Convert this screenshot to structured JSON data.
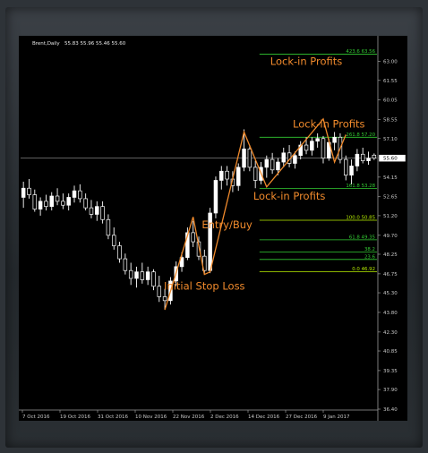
{
  "chart_data": {
    "type": "candlestick",
    "header": {
      "symbol": "Brent,Daily",
      "ohlc": "55.83 55.96 55.46 55.60"
    },
    "y_ticks": [
      "63.00",
      "61.55",
      "60.05",
      "58.55",
      "57.10",
      "55.60",
      "54.15",
      "52.65",
      "51.20",
      "49.70",
      "48.25",
      "46.75",
      "45.30",
      "43.80",
      "42.30",
      "40.85",
      "39.35",
      "37.90",
      "36.40"
    ],
    "current_price": "55.60",
    "ylim": [
      36.4,
      64.0
    ],
    "x_ticks": [
      "7 Oct 2016",
      "19 Oct 2016",
      "31 Oct 2016",
      "10 Nov 2016",
      "22 Nov 2016",
      "2 Dec 2016",
      "14 Dec 2016",
      "27 Dec 2016",
      "9 Jan 2017"
    ],
    "candles": [
      {
        "o": 52.6,
        "h": 53.8,
        "l": 51.8,
        "c": 53.3
      },
      {
        "o": 53.3,
        "h": 54.0,
        "l": 52.5,
        "c": 52.8
      },
      {
        "o": 52.8,
        "h": 53.2,
        "l": 51.5,
        "c": 51.7
      },
      {
        "o": 51.7,
        "h": 52.6,
        "l": 51.2,
        "c": 52.3
      },
      {
        "o": 52.3,
        "h": 52.8,
        "l": 51.6,
        "c": 51.9
      },
      {
        "o": 51.9,
        "h": 53.0,
        "l": 51.6,
        "c": 52.7
      },
      {
        "o": 52.7,
        "h": 53.3,
        "l": 52.0,
        "c": 52.3
      },
      {
        "o": 52.3,
        "h": 52.9,
        "l": 51.7,
        "c": 52.0
      },
      {
        "o": 52.0,
        "h": 52.9,
        "l": 51.6,
        "c": 52.6
      },
      {
        "o": 52.6,
        "h": 53.5,
        "l": 52.2,
        "c": 53.1
      },
      {
        "o": 53.1,
        "h": 53.6,
        "l": 52.2,
        "c": 52.5
      },
      {
        "o": 52.5,
        "h": 52.9,
        "l": 51.6,
        "c": 51.8
      },
      {
        "o": 51.8,
        "h": 52.4,
        "l": 51.0,
        "c": 51.3
      },
      {
        "o": 51.3,
        "h": 52.3,
        "l": 50.8,
        "c": 51.9
      },
      {
        "o": 51.9,
        "h": 52.3,
        "l": 50.6,
        "c": 50.9
      },
      {
        "o": 50.9,
        "h": 51.3,
        "l": 49.4,
        "c": 49.7
      },
      {
        "o": 49.7,
        "h": 50.3,
        "l": 48.6,
        "c": 48.9
      },
      {
        "o": 48.9,
        "h": 49.2,
        "l": 47.6,
        "c": 47.9
      },
      {
        "o": 47.9,
        "h": 48.3,
        "l": 46.7,
        "c": 47.0
      },
      {
        "o": 47.0,
        "h": 47.6,
        "l": 45.9,
        "c": 46.4
      },
      {
        "o": 46.4,
        "h": 47.3,
        "l": 45.7,
        "c": 46.9
      },
      {
        "o": 46.9,
        "h": 47.6,
        "l": 46.0,
        "c": 46.3
      },
      {
        "o": 46.3,
        "h": 47.3,
        "l": 45.9,
        "c": 46.9
      },
      {
        "o": 46.9,
        "h": 47.1,
        "l": 45.5,
        "c": 45.8
      },
      {
        "o": 45.8,
        "h": 46.6,
        "l": 44.6,
        "c": 45.0
      },
      {
        "o": 45.0,
        "h": 45.6,
        "l": 44.0,
        "c": 44.7
      },
      {
        "o": 44.7,
        "h": 46.5,
        "l": 44.4,
        "c": 46.2
      },
      {
        "o": 46.2,
        "h": 47.7,
        "l": 45.8,
        "c": 47.3
      },
      {
        "o": 47.3,
        "h": 48.4,
        "l": 46.9,
        "c": 48.0
      },
      {
        "o": 48.0,
        "h": 50.3,
        "l": 47.8,
        "c": 49.9
      },
      {
        "o": 49.9,
        "h": 50.8,
        "l": 48.8,
        "c": 49.2
      },
      {
        "o": 49.2,
        "h": 49.6,
        "l": 47.8,
        "c": 48.1
      },
      {
        "o": 48.1,
        "h": 48.6,
        "l": 46.7,
        "c": 47.0
      },
      {
        "o": 47.0,
        "h": 51.8,
        "l": 46.8,
        "c": 51.4
      },
      {
        "o": 51.4,
        "h": 54.2,
        "l": 51.0,
        "c": 53.9
      },
      {
        "o": 53.9,
        "h": 55.0,
        "l": 53.2,
        "c": 54.6
      },
      {
        "o": 54.6,
        "h": 55.0,
        "l": 53.5,
        "c": 54.0
      },
      {
        "o": 54.0,
        "h": 54.6,
        "l": 53.0,
        "c": 53.5
      },
      {
        "o": 53.5,
        "h": 55.2,
        "l": 53.1,
        "c": 54.9
      },
      {
        "o": 54.9,
        "h": 57.8,
        "l": 54.6,
        "c": 56.3
      },
      {
        "o": 56.3,
        "h": 56.6,
        "l": 54.6,
        "c": 54.9
      },
      {
        "o": 54.9,
        "h": 55.4,
        "l": 53.3,
        "c": 53.9
      },
      {
        "o": 53.9,
        "h": 55.3,
        "l": 53.6,
        "c": 54.9
      },
      {
        "o": 54.9,
        "h": 55.8,
        "l": 54.1,
        "c": 55.5
      },
      {
        "o": 55.5,
        "h": 56.0,
        "l": 54.4,
        "c": 54.7
      },
      {
        "o": 54.7,
        "h": 55.6,
        "l": 54.3,
        "c": 55.3
      },
      {
        "o": 55.3,
        "h": 56.4,
        "l": 54.9,
        "c": 56.0
      },
      {
        "o": 56.0,
        "h": 56.6,
        "l": 54.9,
        "c": 55.2
      },
      {
        "o": 55.2,
        "h": 56.1,
        "l": 54.8,
        "c": 55.8
      },
      {
        "o": 55.8,
        "h": 56.9,
        "l": 55.5,
        "c": 56.6
      },
      {
        "o": 56.6,
        "h": 57.2,
        "l": 55.9,
        "c": 56.2
      },
      {
        "o": 56.2,
        "h": 57.2,
        "l": 55.8,
        "c": 56.9
      },
      {
        "o": 56.9,
        "h": 57.5,
        "l": 56.4,
        "c": 57.1
      },
      {
        "o": 57.1,
        "h": 57.3,
        "l": 55.2,
        "c": 55.6
      },
      {
        "o": 55.6,
        "h": 57.1,
        "l": 55.4,
        "c": 56.8
      },
      {
        "o": 56.8,
        "h": 57.6,
        "l": 56.2,
        "c": 57.2
      },
      {
        "o": 57.2,
        "h": 57.5,
        "l": 55.2,
        "c": 55.5
      },
      {
        "o": 55.5,
        "h": 55.8,
        "l": 53.9,
        "c": 54.3
      },
      {
        "o": 54.3,
        "h": 55.5,
        "l": 53.6,
        "c": 55.0
      },
      {
        "o": 55.0,
        "h": 56.3,
        "l": 54.6,
        "c": 55.9
      },
      {
        "o": 55.9,
        "h": 56.4,
        "l": 55.2,
        "c": 55.4
      },
      {
        "o": 55.4,
        "h": 56.1,
        "l": 55.1,
        "c": 55.6
      },
      {
        "o": 55.83,
        "h": 55.96,
        "l": 55.46,
        "c": 55.6
      }
    ],
    "fib_levels": [
      {
        "label": "423.6  63.56",
        "price": 63.56,
        "start_bar": 43,
        "color": "#33cc33"
      },
      {
        "label": "261.8  57.20",
        "price": 57.2,
        "start_bar": 43,
        "color": "#33cc33"
      },
      {
        "label": "161.8  53.28",
        "price": 53.28,
        "start_bar": 43,
        "color": "#33cc33"
      },
      {
        "label": "100.0  50.85",
        "price": 50.85,
        "start_bar": 43,
        "color": "#b8f000"
      },
      {
        "label": "61.8  49.35",
        "price": 49.35,
        "start_bar": 43,
        "color": "#33cc33"
      },
      {
        "label": "38.2",
        "price": 48.42,
        "start_bar": 43,
        "color": "#33cc33"
      },
      {
        "label": "23.6",
        "price": 47.85,
        "start_bar": 43,
        "color": "#33cc33"
      },
      {
        "label": "0.0  46.92",
        "price": 46.92,
        "start_bar": 43,
        "color": "#b8f000"
      }
    ],
    "zigzag": [
      [
        25,
        44.0
      ],
      [
        30,
        51.1
      ],
      [
        32,
        46.7
      ],
      [
        33,
        46.9
      ],
      [
        39,
        57.6
      ],
      [
        43,
        53.4
      ],
      [
        53,
        58.6
      ],
      [
        55,
        55.3
      ],
      [
        57,
        57.4
      ]
    ],
    "zigzag_color": "#f08a2c",
    "annotations": [
      {
        "text": "Lock-in Profits",
        "price": 63.0,
        "bar": 50
      },
      {
        "text": "Lock-in Profits",
        "price": 58.2,
        "bar": 54
      },
      {
        "text": "Lock-in Profits",
        "price": 52.7,
        "bar": 47
      },
      {
        "text": "Entry/Buy",
        "price": 50.5,
        "bar": 36
      },
      {
        "text": "Initial Stop Loss",
        "price": 45.8,
        "bar": 32
      }
    ],
    "annotation_color": "#f08a2c",
    "up_color": "#ffffff",
    "down_color": "#000000",
    "wick_color": "#ffffff",
    "current_price_line_color": "#808080"
  }
}
